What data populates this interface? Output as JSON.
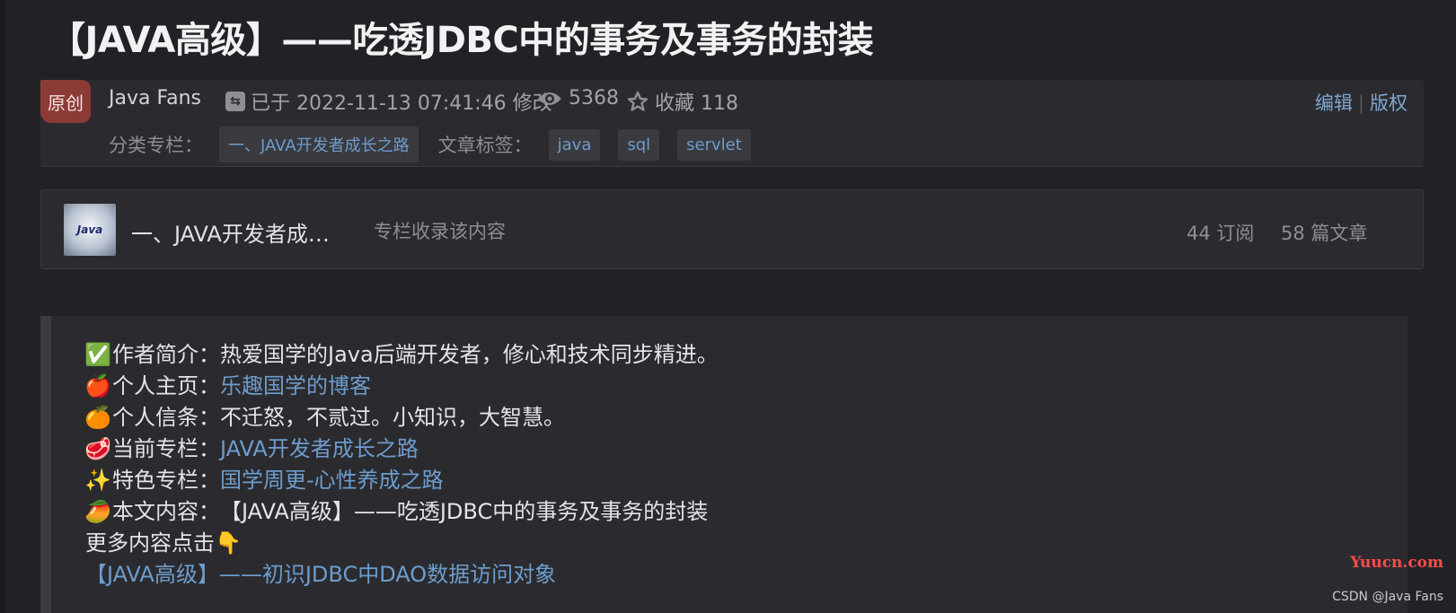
{
  "article": {
    "title": "【JAVA高级】——吃透JDBC中的事务及事务的封装"
  },
  "meta": {
    "badge": "原创",
    "author": "Java Fans",
    "modified": "已于 2022-11-13 07:41:46 修改",
    "views": "5368",
    "favorites": "收藏 118",
    "edit_label": "编辑",
    "copyright_label": "版权",
    "category_label": "分类专栏：",
    "category": "一、JAVA开发者成长之路",
    "tags_label": "文章标签：",
    "tags": [
      "java",
      "sql",
      "servlet"
    ]
  },
  "column": {
    "thumb_text": "Java",
    "title": "一、JAVA开发者成…",
    "note": "专栏收录该内容",
    "subscribers": "44 订阅",
    "articles": "58 篇文章"
  },
  "intro": [
    {
      "emoji": "✅",
      "label": "作者简介：",
      "value": "热爱国学的Java后端开发者，修心和技术同步精进。",
      "is_link": false
    },
    {
      "emoji": "🍎",
      "label": "个人主页：",
      "value": "乐趣国学的博客",
      "is_link": true
    },
    {
      "emoji": "🍊",
      "label": "个人信条：",
      "value": "不迁怒，不贰过。小知识，大智慧。",
      "is_link": false
    },
    {
      "emoji": "🥩",
      "label": "当前专栏：",
      "value": "JAVA开发者成长之路",
      "is_link": true
    },
    {
      "emoji": "✨",
      "label": "特色专栏：",
      "value": "国学周更-心性养成之路",
      "is_link": true
    },
    {
      "emoji": "🥭",
      "label": "本文内容：",
      "value": "【JAVA高级】——吃透JDBC中的事务及事务的封装",
      "is_link": false
    }
  ],
  "more": {
    "text": "更多内容点击",
    "emoji": "👇",
    "link": "【JAVA高级】——初识JDBC中DAO数据访问对象"
  },
  "watermarks": {
    "site": "Yuucn.com",
    "csdn": "CSDN @Java Fans"
  },
  "colors": {
    "background": "#222226",
    "card": "#2b2b2f",
    "link": "#6d9ccc",
    "badge": "#8c3a36"
  },
  "icons": [
    "edit-icon",
    "eye-icon",
    "star-icon",
    "pointing-down-icon"
  ]
}
